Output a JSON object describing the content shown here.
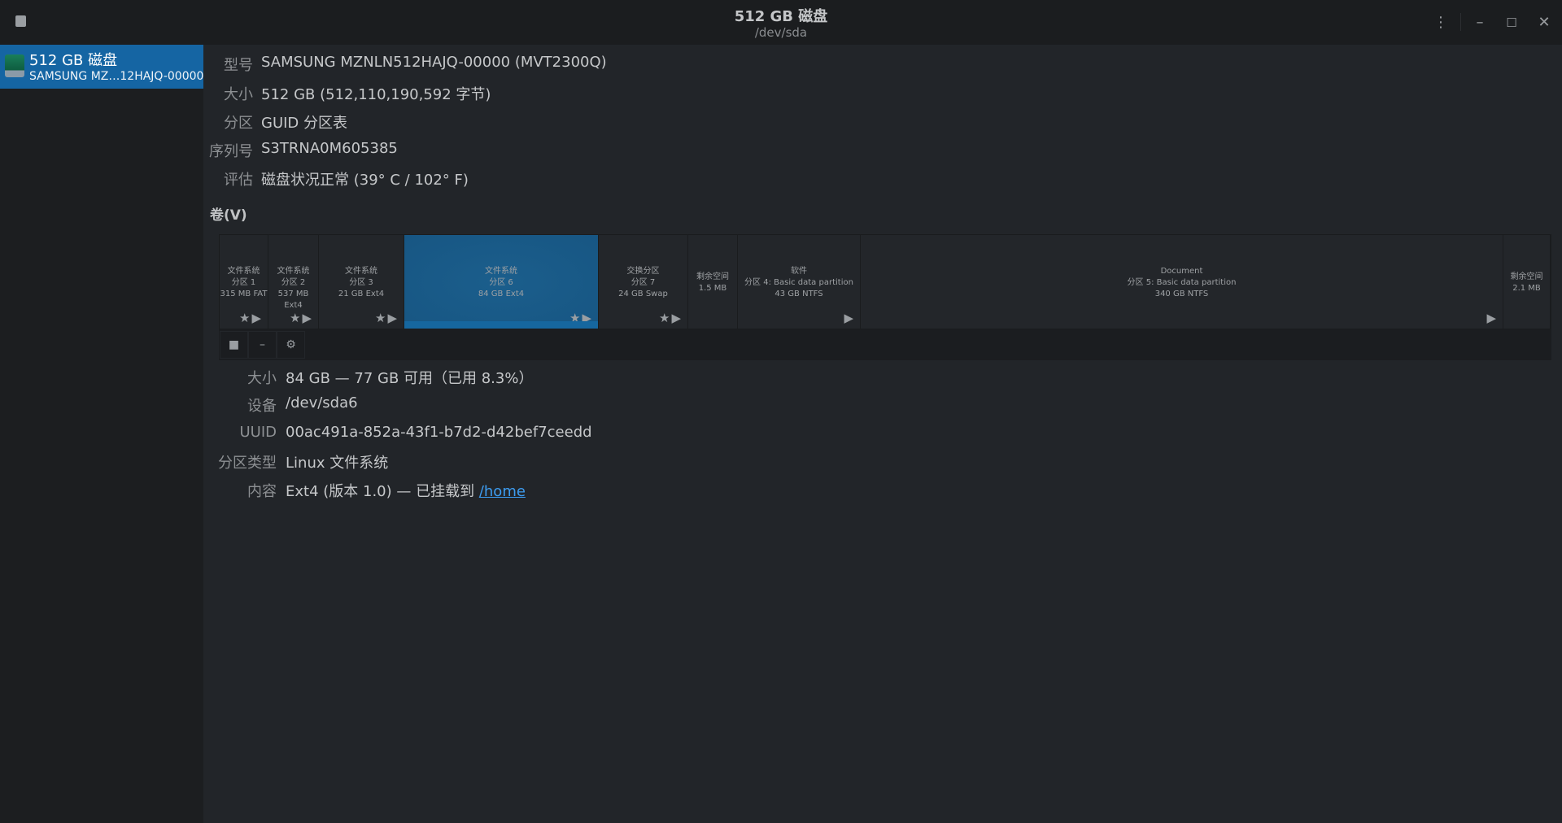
{
  "window": {
    "title": "512 GB 磁盘",
    "subtitle": "/dev/sda",
    "menu_icon": "kebab-menu-icon"
  },
  "sidebar": {
    "items": [
      {
        "name": "512 GB 磁盘",
        "model": "SAMSUNG MZ…12HAJQ-00000",
        "selected": true
      }
    ]
  },
  "disk_info": [
    {
      "label": "型号",
      "value": "SAMSUNG MZNLN512HAJQ-00000 (MVT2300Q)"
    },
    {
      "label": "大小",
      "value": "512 GB (512,110,190,592 字节)"
    },
    {
      "label": "分区",
      "value": "GUID 分区表"
    },
    {
      "label": "序列号",
      "value": "S3TRNA0M605385"
    },
    {
      "label": "评估",
      "value": "磁盘状况正常 (39° C / 102° F)"
    }
  ],
  "volumes_heading": "卷(V)",
  "partitions": [
    {
      "l1": "文件系统",
      "l2": "分区 1",
      "l3": "315 MB FAT",
      "icons": "★▶"
    },
    {
      "l1": "文件系统",
      "l2": "分区 2",
      "l3": "537 MB Ext4",
      "icons": "★▶"
    },
    {
      "l1": "文件系统",
      "l2": "分区 3",
      "l3": "21 GB Ext4",
      "icons": "★▶"
    },
    {
      "l1": "文件系统",
      "l2": "分区 6",
      "l3": "84 GB Ext4",
      "icons": "★▶",
      "selected": true
    },
    {
      "l1": "交换分区",
      "l2": "分区 7",
      "l3": "24 GB Swap",
      "icons": "★▶"
    },
    {
      "l1": "剩余空间",
      "l2": "1.5 MB",
      "l3": "",
      "icons": ""
    },
    {
      "l1": "软件",
      "l2": "分区 4:  Basic data partition",
      "l3": "43 GB NTFS",
      "icons": "▶"
    },
    {
      "l1": "Document",
      "l2": "分区 5:  Basic data partition",
      "l3": "340 GB NTFS",
      "icons": "▶"
    },
    {
      "l1": "剩余空间",
      "l2": "2.1 MB",
      "l3": "",
      "icons": ""
    }
  ],
  "volume_info": [
    {
      "label": "大小",
      "value": "84 GB — 77 GB 可用（已用 8.3%）"
    },
    {
      "label": "设备",
      "value": "/dev/sda6"
    },
    {
      "label": "UUID",
      "value": "00ac491a-852a-43f1-b7d2-d42bef7ceedd"
    },
    {
      "label": "分区类型",
      "value": "Linux 文件系统"
    },
    {
      "label": "内容",
      "value": "Ext4 (版本 1.0) — 已挂载到 ",
      "link": "/home"
    }
  ]
}
